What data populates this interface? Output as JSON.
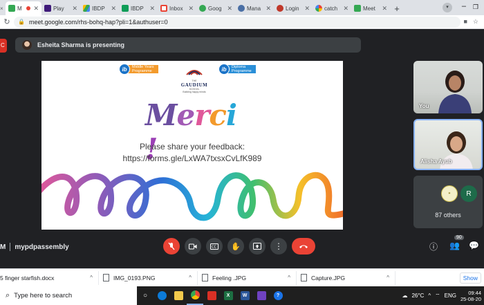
{
  "browser": {
    "tabs": [
      {
        "label": "M",
        "color": "#34a853",
        "active": true
      },
      {
        "label": "Play",
        "color": "#1a0dab"
      },
      {
        "label": "IBDP",
        "color": "#0f9d58"
      },
      {
        "label": "IBDP",
        "color": "#0f9d58"
      },
      {
        "label": "Inbox",
        "color": "#ea4335"
      },
      {
        "label": "Goog",
        "color": "#34a853"
      },
      {
        "label": "Mana",
        "color": "#4285f4"
      },
      {
        "label": "Login",
        "color": "#4285f4"
      },
      {
        "label": "catch",
        "color": "#4285f4"
      },
      {
        "label": "Meet",
        "color": "#34a853"
      }
    ],
    "tab_close": "✕",
    "new_tab": "+",
    "url": "meet.google.com/rhs-bohq-hap?pli=1&authuser=0"
  },
  "meet": {
    "left_badge": "C",
    "presenter_text": "Esheita Sharma is presenting",
    "slide": {
      "myp_text_1": "Middle Years",
      "myp_text_2": "Programme",
      "dp_text_1": "Diploma",
      "dp_text_2": "Programme",
      "school_the": "THE",
      "school_name": "GAUDIUM",
      "school_word": "SCHOOL",
      "school_tagline": "Building happy minds",
      "ib_mark": "ib",
      "merci": [
        "M",
        "e",
        "r",
        "c",
        "i",
        " ",
        "!"
      ],
      "merci_colors": [
        "#6b4fa0",
        "#a25ab5",
        "#e0589a",
        "#f39a2c",
        "#27a7d8",
        "#ffffff",
        "#9b3fb5"
      ],
      "feedback_line1": "Please share your feedback:",
      "feedback_line2": "https://forms.gle/LxWA7txsxCvLfK989"
    },
    "tiles": {
      "you_label": "You",
      "alisha_label": "Alisha Ayub",
      "others_initial": "R",
      "others_count": "87 others"
    },
    "meeting_code": "M",
    "meeting_name": "mypdpassembly",
    "people_badge": "90"
  },
  "downloads": [
    {
      "name": "5 finger starfish.docx"
    },
    {
      "name": "IMG_0193.PNG"
    },
    {
      "name": "Feeling .JPG"
    },
    {
      "name": "Capture.JPG"
    }
  ],
  "downloads_show_all": "Show",
  "taskbar": {
    "search_placeholder": "Type here to search",
    "weather": "26°C",
    "language": "ENG",
    "time": "09:44",
    "date": "25-08-20"
  }
}
